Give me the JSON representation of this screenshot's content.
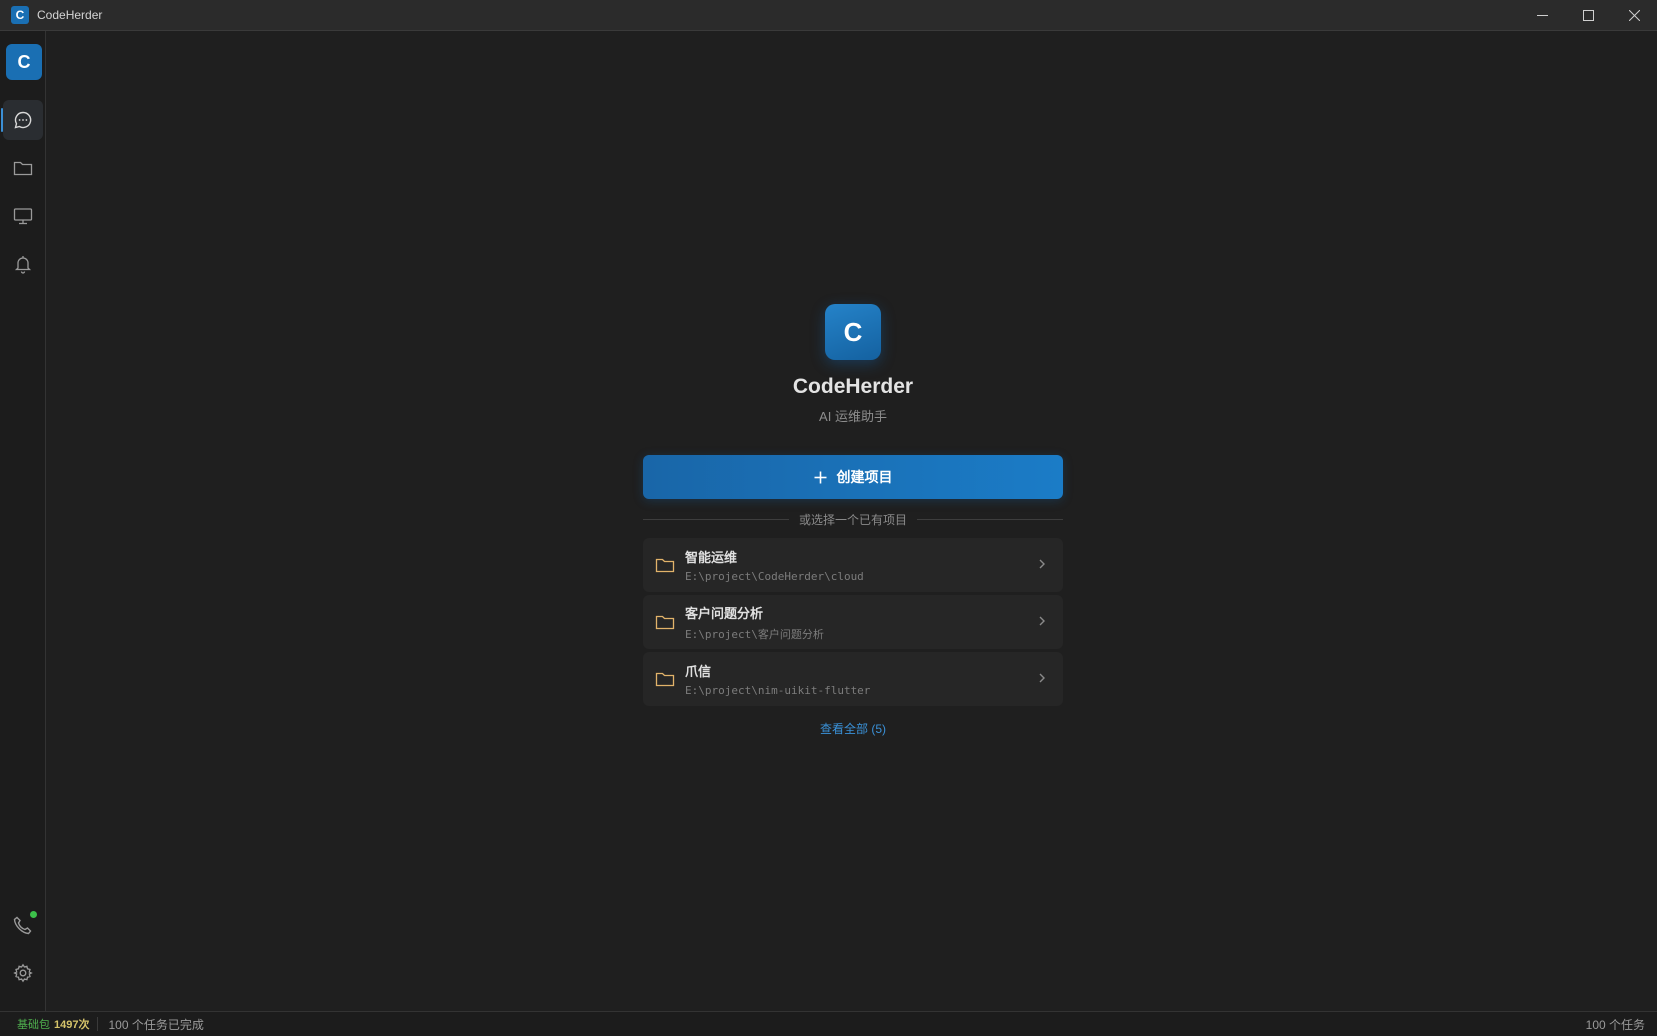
{
  "titlebar": {
    "logo_letter": "C",
    "title": "CodeHerder",
    "controls": [
      "minimize-icon",
      "maximize-icon",
      "close-icon"
    ]
  },
  "sidebar": {
    "logo_letter": "C",
    "items": [
      {
        "icon": "chat-icon",
        "active": true
      },
      {
        "icon": "folder-icon",
        "active": false
      },
      {
        "icon": "monitor-icon",
        "active": false
      },
      {
        "icon": "bell-icon",
        "active": false
      }
    ],
    "bottom_items": [
      {
        "icon": "phone-icon",
        "status": "online",
        "status_color": "#3cc04a"
      },
      {
        "icon": "gear-icon"
      }
    ]
  },
  "hero": {
    "logo_letter": "C",
    "title": "CodeHerder",
    "subtitle": "AI 运维助手"
  },
  "create_button": {
    "icon": "plus-icon",
    "label": "创建项目"
  },
  "divider_text": "或选择一个已有项目",
  "projects": [
    {
      "name": "智能运维",
      "path": "E:\\project\\CodeHerder\\cloud"
    },
    {
      "name": "客户问题分析",
      "path": "E:\\project\\客户问题分析"
    },
    {
      "name": "爪信",
      "path": "E:\\project\\nim-uikit-flutter"
    }
  ],
  "view_all": "查看全部 (5)",
  "statusbar": {
    "package_label": "基础包",
    "package_count": "1497次",
    "tasks_done": "100 个任务已完成",
    "tasks_total": "100 个任务"
  },
  "colors": {
    "accent": "#1b7cc7",
    "folder": "#e2b36a",
    "link": "#3a91d8",
    "online": "#3cc04a"
  }
}
